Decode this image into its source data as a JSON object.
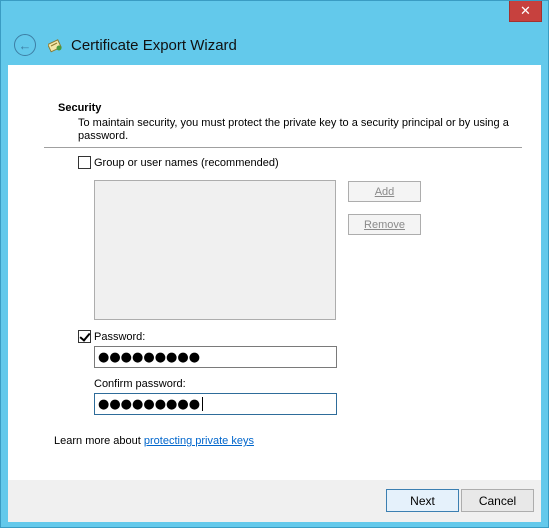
{
  "window": {
    "title": "Certificate Export Wizard",
    "close_label": "✕"
  },
  "security": {
    "heading": "Security",
    "description": "To maintain security, you must protect the private key to a security principal or by using a password.",
    "group_checkbox_label": "Group or user names (recommended)",
    "group_checked": false,
    "add_label": "Add",
    "remove_label": "Remove",
    "password_checkbox_label": "Password:",
    "password_checked": true,
    "password_value": "●●●●●●●●●",
    "confirm_label": "Confirm password:",
    "confirm_value": "●●●●●●●●●"
  },
  "learn_more": {
    "prefix": "Learn more about ",
    "link": "protecting private keys"
  },
  "buttons": {
    "next": "Next",
    "cancel": "Cancel"
  },
  "icons": {
    "back": "back-arrow-icon",
    "certificate": "certificate-icon"
  }
}
